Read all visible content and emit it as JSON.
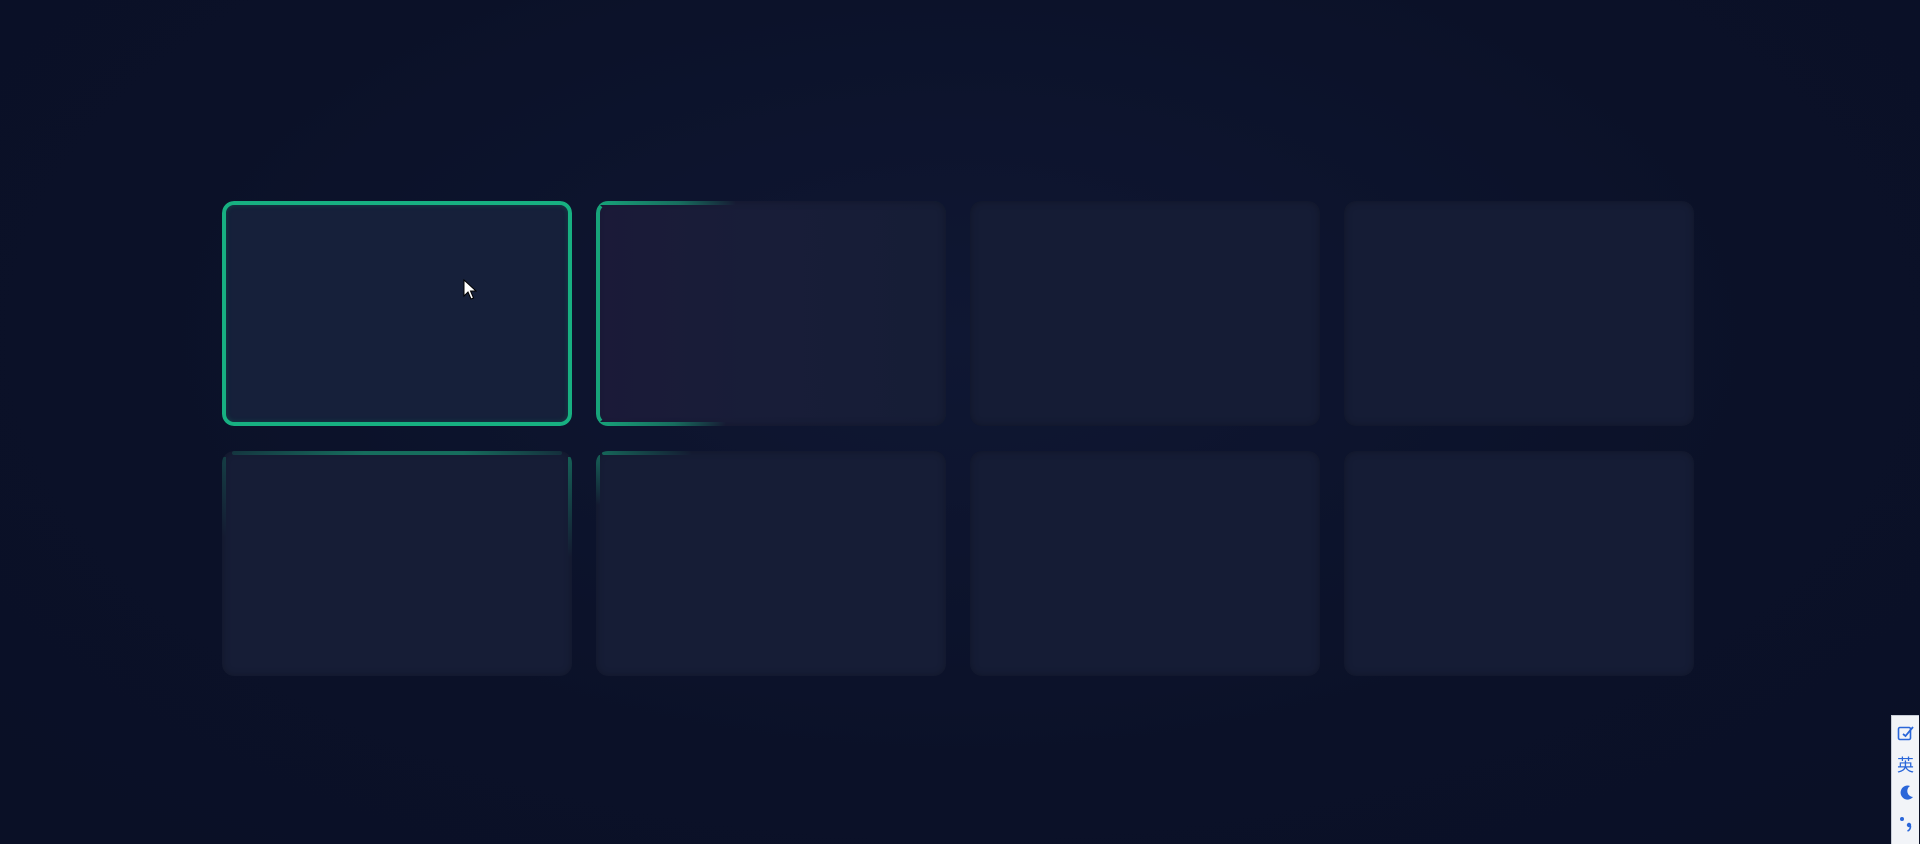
{
  "page": {
    "background_color": "#0b1128",
    "accent_color": "#17b081"
  },
  "cards": [
    {
      "row": 1,
      "col": 1,
      "state": "active"
    },
    {
      "row": 1,
      "col": 2,
      "state": "partial-glow"
    },
    {
      "row": 1,
      "col": 3,
      "state": "idle"
    },
    {
      "row": 1,
      "col": 4,
      "state": "idle"
    },
    {
      "row": 2,
      "col": 1,
      "state": "faint-glow"
    },
    {
      "row": 2,
      "col": 2,
      "state": "faint-glow"
    },
    {
      "row": 2,
      "col": 3,
      "state": "idle"
    },
    {
      "row": 2,
      "col": 4,
      "state": "idle"
    }
  ],
  "ime_toolbar": {
    "buttons": [
      {
        "name": "ime-settings-icon",
        "icon": "checkbox-pen-icon"
      },
      {
        "name": "ime-language-toggle",
        "label": "英"
      },
      {
        "name": "ime-moon-icon",
        "icon": "moon-icon"
      },
      {
        "name": "ime-punctuation-icon",
        "icon": "punctuation-icon"
      }
    ]
  },
  "cursor": {
    "icon": "mouse-pointer-icon"
  }
}
